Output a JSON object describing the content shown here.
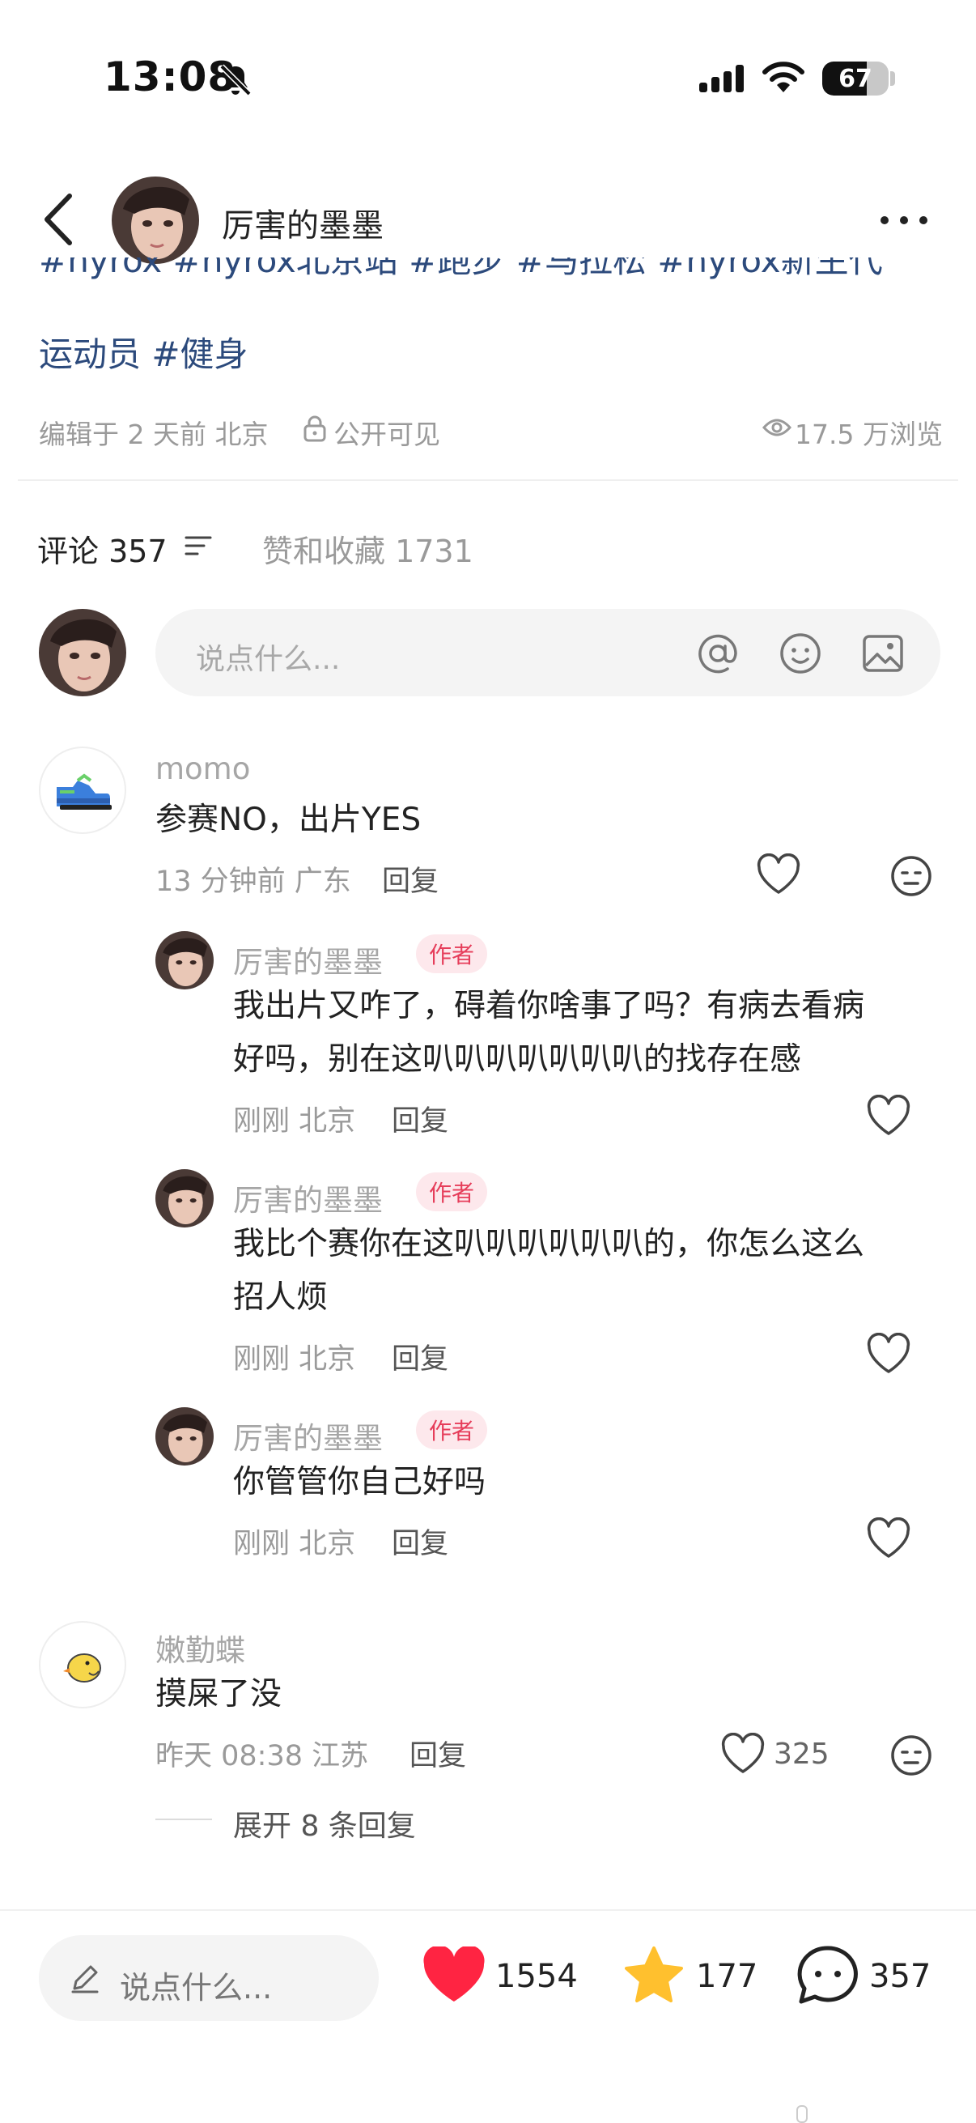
{
  "status_bar": {
    "time": "13:08",
    "battery": "67",
    "battery_level": 0.67
  },
  "header": {
    "name": "厉害的墨墨"
  },
  "post": {
    "tags_line1": "#hyrox #hyrox北京站 #跑步 #马拉松 #hyrox新生代",
    "tags_line2": "运动员 #健身",
    "edited": "编辑于 2 天前 北京",
    "visibility": "公开可见",
    "views": "17.5 万浏览"
  },
  "tabs": {
    "comments": "评论 357",
    "likes": "赞和收藏 1731"
  },
  "comment_input": {
    "placeholder": "说点什么..."
  },
  "comments": [
    {
      "name": "momo",
      "text": "参赛NO，出片YES",
      "meta": "13 分钟前 广东",
      "reply": "回复",
      "replies": [
        {
          "name": "厉害的墨墨",
          "badge": "作者",
          "line1": "我出片又咋了，碍着你啥事了吗？有病去看病",
          "line2": "好吗，别在这叭叭叭叭叭叭叭的找存在感",
          "meta": "刚刚 北京",
          "reply": "回复"
        },
        {
          "name": "厉害的墨墨",
          "badge": "作者",
          "line1": "我比个赛你在这叭叭叭叭叭叭的，你怎么这么",
          "line2": "招人烦",
          "meta": "刚刚 北京",
          "reply": "回复"
        },
        {
          "name": "厉害的墨墨",
          "badge": "作者",
          "line1": "你管管你自己好吗",
          "meta": "刚刚 北京",
          "reply": "回复"
        }
      ]
    },
    {
      "name": "嫩勤蝶",
      "text": "摸屎了没",
      "meta": "昨天 08:38 江苏",
      "reply": "回复",
      "likes": "325",
      "expand": "展开 8 条回复"
    }
  ],
  "bottom_bar": {
    "placeholder": "说点什么...",
    "likes": "1554",
    "stars": "177",
    "comments": "357"
  },
  "colors": {
    "accent_red": "#ff2442",
    "tag_blue": "#2c4a7c",
    "star_yellow": "#ffc02e"
  }
}
